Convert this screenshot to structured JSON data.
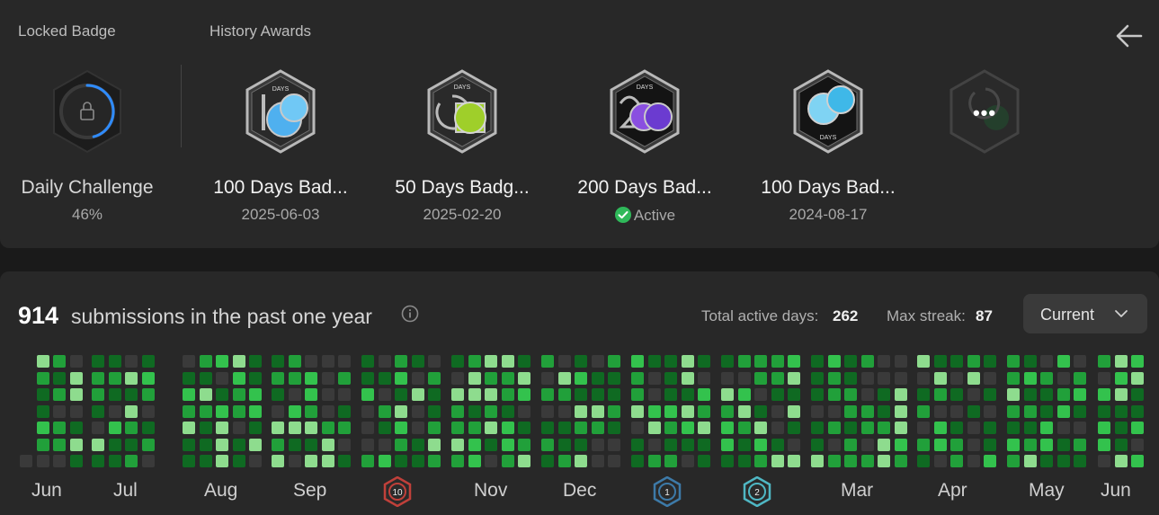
{
  "header": {
    "locked_label": "Locked Badge",
    "history_label": "History Awards"
  },
  "locked_badge": {
    "title": "Daily Challenge",
    "progress_text": "46%",
    "progress": 0.46
  },
  "history_awards": [
    {
      "title": "100 Days Bad...",
      "date": "2025-06-03",
      "art_text": "DAYS",
      "color": "#4fb0ef"
    },
    {
      "title": "50 Days Badg...",
      "date": "2025-02-20",
      "art_text": "DAYS",
      "color": "#9fcf2a"
    },
    {
      "title": "200 Days Bad...",
      "status": "Active",
      "art_text": "DAYS",
      "color": "#8a4fe0"
    },
    {
      "title": "100 Days Bad...",
      "date": "2024-08-17",
      "art_text": "DAYS",
      "color": "#3fb8e8"
    }
  ],
  "more_label": "•••",
  "submissions": {
    "count": "914",
    "text": "submissions in the past one year",
    "total_active_label": "Total active days:",
    "total_active_value": "262",
    "max_streak_label": "Max streak:",
    "max_streak_value": "87",
    "year_select": "Current"
  },
  "calendar": {
    "months": [
      {
        "label": "Jun"
      },
      {
        "label": "Jul"
      },
      {
        "label": "Aug"
      },
      {
        "label": "Sep"
      },
      {
        "label": "",
        "badge": "10",
        "badge_color": "#c0403a"
      },
      {
        "label": "Nov"
      },
      {
        "label": "Dec"
      },
      {
        "label": "",
        "badge": "1",
        "badge_color": "#3d7aa8"
      },
      {
        "label": "",
        "badge": "2",
        "badge_color": "#4fb7c4"
      },
      {
        "label": "Mar"
      },
      {
        "label": "Apr"
      },
      {
        "label": "May"
      },
      {
        "label": "Jun"
      }
    ],
    "levels_colors": [
      "#3a3a3a",
      "#0f6a22",
      "#21a03a",
      "#33c24d",
      "#8edc8e"
    ]
  },
  "icons": {
    "back": "arrow-left-icon",
    "info": "info-circle-icon",
    "lock": "lock-icon",
    "chevron": "chevron-down-icon",
    "active": "check-circle-icon"
  }
}
